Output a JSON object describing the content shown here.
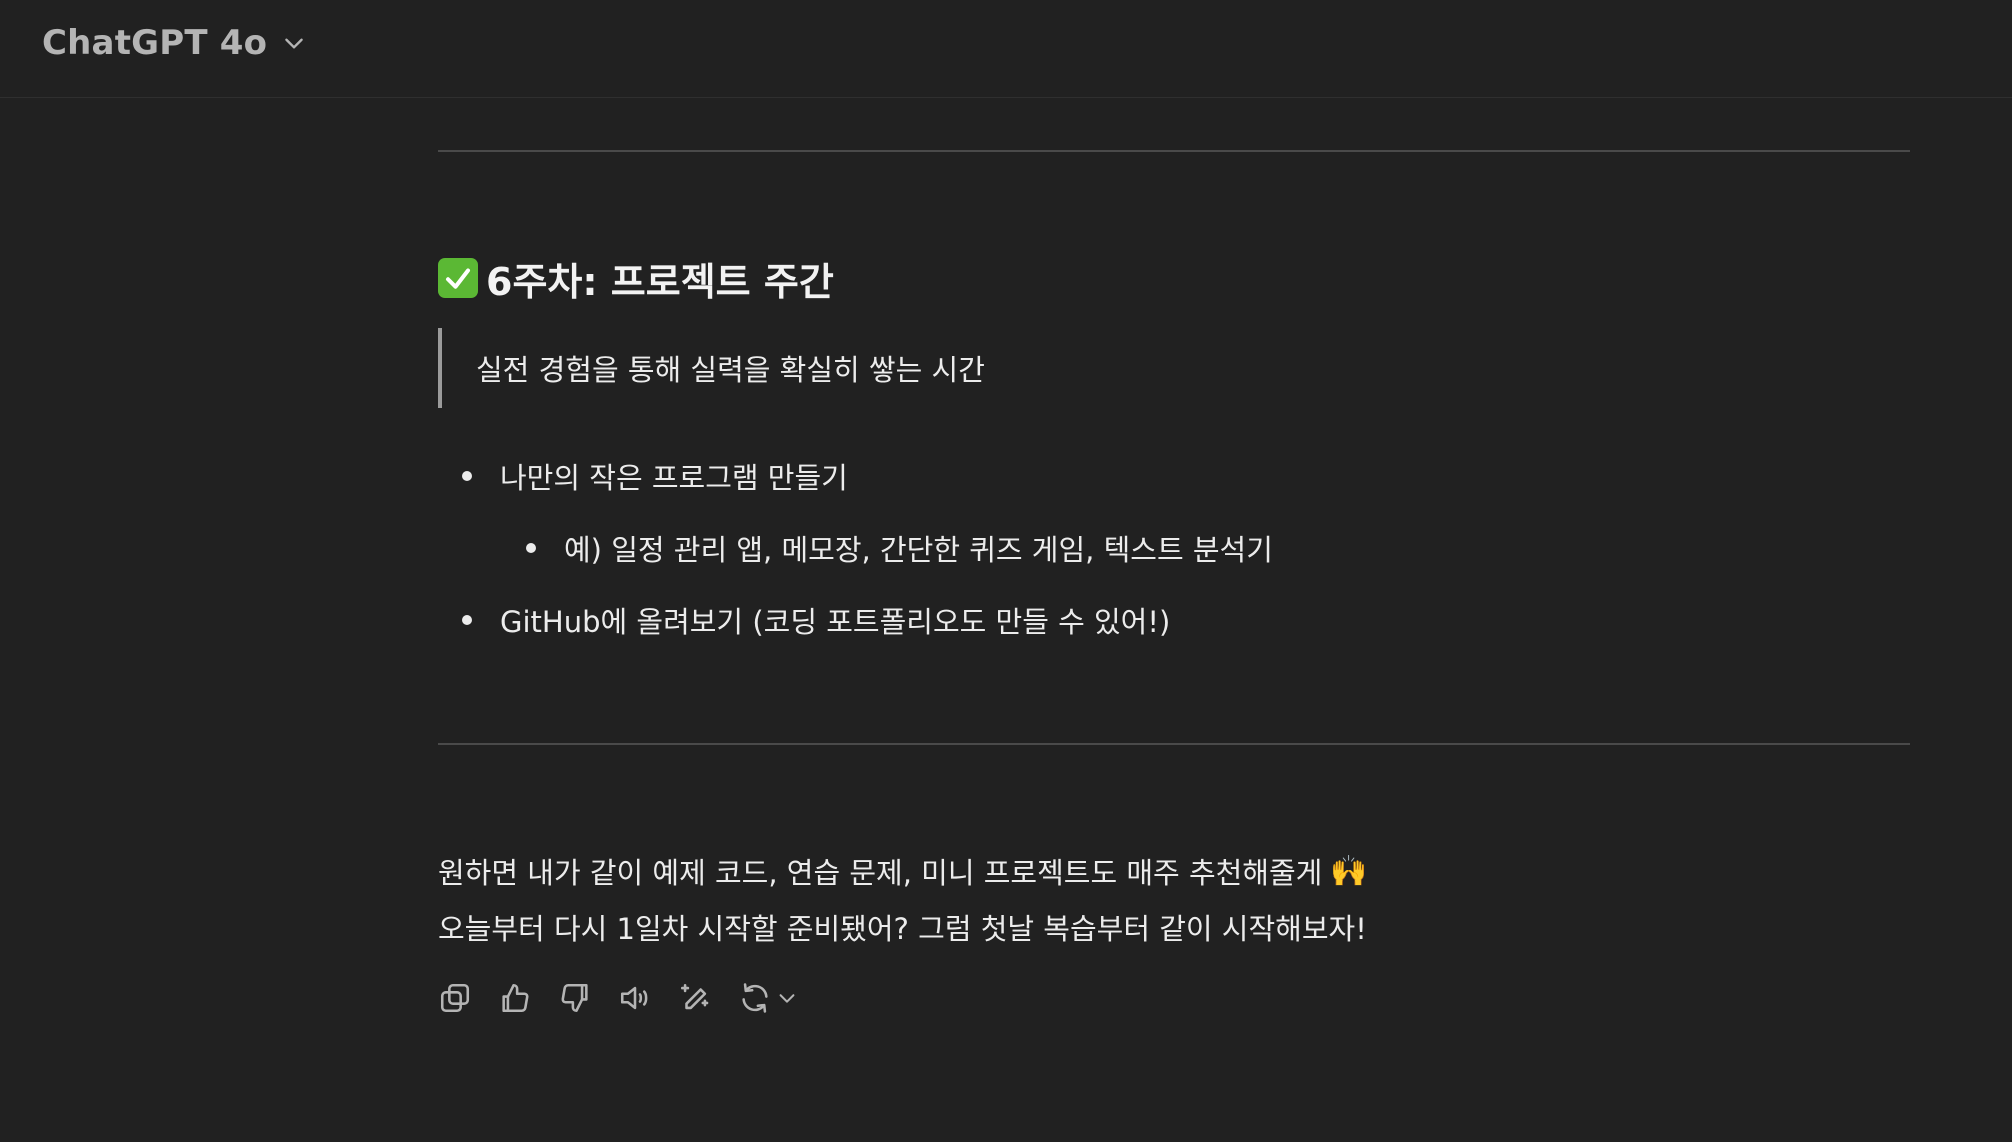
{
  "header": {
    "model_name": "ChatGPT 4o",
    "model_dropdown_icon": "chevron-down-icon"
  },
  "message": {
    "section_heading": "6주차: 프로젝트 주간",
    "section_heading_icon": "check-mark-button-emoji",
    "blockquote": "실전 경험을 통해 실력을 확실히 쌓는 시간",
    "list": [
      {
        "text": "나만의 작은 프로그램 만들기",
        "children": [
          "예) 일정 관리 앱, 메모장, 간단한 퀴즈 게임, 텍스트 분석기"
        ]
      },
      {
        "text": "GitHub에 올려보기 (코딩 포트폴리오도 만들 수 있어!)"
      }
    ],
    "closing_line_1": "원하면 내가 같이 예제 코드, 연습 문제, 미니 프로젝트도 매주 추천해줄게",
    "closing_line_1_emoji": "🙌",
    "closing_line_2": "오늘부터 다시 1일차 시작할 준비됐어? 그럼 첫날 복습부터 같이 시작해보자!"
  },
  "actions": [
    {
      "icon": "copy-icon"
    },
    {
      "icon": "thumbs-up-icon"
    },
    {
      "icon": "thumbs-down-icon"
    },
    {
      "icon": "read-aloud-icon"
    },
    {
      "icon": "edit-sparkle-icon"
    },
    {
      "icon": "regenerate-icon"
    }
  ],
  "colors": {
    "background": "#212121",
    "text": "#ececec",
    "muted": "#b4b4b4",
    "divider": "#4a4a4a",
    "check_green": "#5bb834"
  }
}
